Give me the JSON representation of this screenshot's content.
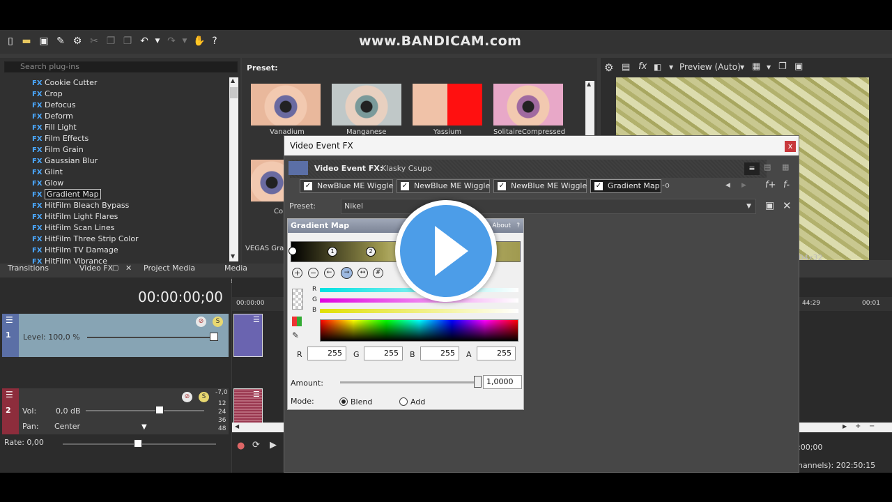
{
  "watermark": "www.BANDICAM.com",
  "plugins": {
    "search_placeholder": "Search plug-ins",
    "items": [
      "Cookie Cutter",
      "Crop",
      "Defocus",
      "Deform",
      "Fill Light",
      "Film Effects",
      "Film Grain",
      "Gaussian Blur",
      "Glint",
      "Glow",
      "Gradient Map",
      "HitFilm Bleach Bypass",
      "HitFilm Light Flares",
      "HitFilm Scan Lines",
      "HitFilm Three Strip Color",
      "HitFilm TV Damage",
      "HitFilm Vibrance"
    ],
    "selected": "Gradient Map",
    "fx_badge": "FX"
  },
  "preset_panel": {
    "label": "Preset:",
    "thumbs": [
      "Vanadium",
      "Manganese",
      "Yassium",
      "SolitaireCompressed"
    ],
    "row2_label": "Co",
    "row3_label": "VEGAS Grad"
  },
  "preview": {
    "mode": "Preview (Auto)",
    "res_fragment": "04x32"
  },
  "tabs": {
    "transitions": "Transitions",
    "video_fx": "Video FX",
    "project_media": "Project Media",
    "media_generators": "Media Generators"
  },
  "timeline": {
    "timecode": "00:00:00;00",
    "ruler_start": "00:00:00",
    "ruler_r1": "44:29",
    "ruler_r2": "00:01",
    "video_track": {
      "num": "1",
      "level_label": "Level: 100,0 %"
    },
    "audio_track": {
      "num": "2",
      "vol_label": "Vol:",
      "vol_value": "0,0 dB",
      "pan_label": "Pan:",
      "pan_value": "Center",
      "meter_top": "-7,0",
      "meter_marks": [
        "12",
        "24",
        "36",
        "48"
      ]
    },
    "rate": "Rate: 0,00",
    "right_time": ":00;00",
    "status": "hannels): 202:50:15"
  },
  "dialog": {
    "title": "Video Event FX",
    "close": "x",
    "chain_label": "Video Event FX:",
    "chain_event": "Klasky Csupo",
    "chain": [
      "NewBlue ME Wiggle",
      "NewBlue ME Wiggle",
      "NewBlue ME Wiggle",
      "Gradient Map"
    ],
    "active_chip": "Gradient Map",
    "preset_label": "Preset:",
    "preset_value": "Nikel",
    "gmap": {
      "title": "Gradient Map",
      "about": "About",
      "help": "?",
      "stop1": "1",
      "stop2": "2",
      "channels": [
        "R",
        "G",
        "B"
      ],
      "r_label": "R",
      "r_value": "255",
      "g_label": "G",
      "g_value": "255",
      "b_label": "B",
      "b_value": "255",
      "a_label": "A",
      "a_value": "255",
      "amount_label": "Amount:",
      "amount_value": "1,0000",
      "mode_label": "Mode:",
      "mode_blend": "Blend",
      "mode_add": "Add",
      "mode_selected": "Blend"
    }
  }
}
